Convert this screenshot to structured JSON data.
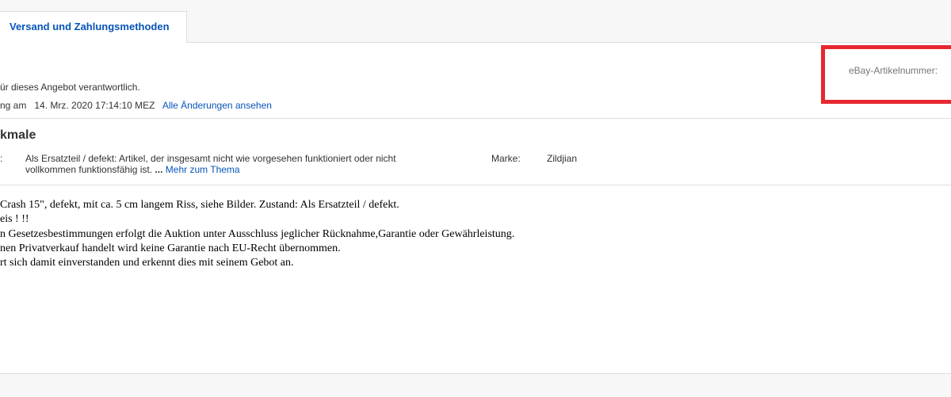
{
  "tabs": {
    "shipping_label": "Versand und Zahlungsmethoden"
  },
  "header": {
    "responsible_text": "ür dieses Angebot verantwortlich.",
    "update_label": "ng am",
    "update_date": "14. Mrz. 2020 17:14:10 MEZ",
    "changes_link": "Alle Änderungen ansehen",
    "item_number_label": "eBay-Artikelnummer:"
  },
  "features": {
    "title": "kmale",
    "condition_label_fragment": ":",
    "condition_line1": "Als Ersatzteil / defekt: Artikel, der insgesamt nicht wie vorgesehen funktioniert oder nicht",
    "condition_line2": "vollkommen funktionsfähig ist.",
    "ellipsis": "...",
    "more_link": "Mehr zum Thema",
    "brand_label": "Marke:",
    "brand_value": "Zildjian"
  },
  "description": {
    "lines": [
      "Crash 15\", defekt, mit ca. 5 cm langem Riss, siehe Bilder. Zustand: Als Ersatzteil / defekt.",
      "eis ! !!",
      "n Gesetzesbestimmungen erfolgt die Auktion unter Ausschluss jeglicher Rücknahme,Garantie oder Gewährleistung.",
      "nen Privatverkauf handelt wird keine Garantie nach EU-Recht übernommen.",
      "rt sich damit einverstanden und erkennt dies mit seinem Gebot an."
    ]
  },
  "colors": {
    "link": "#0654ba",
    "highlight": "#e8272f",
    "text": "#333333",
    "divider": "#dddddd"
  }
}
